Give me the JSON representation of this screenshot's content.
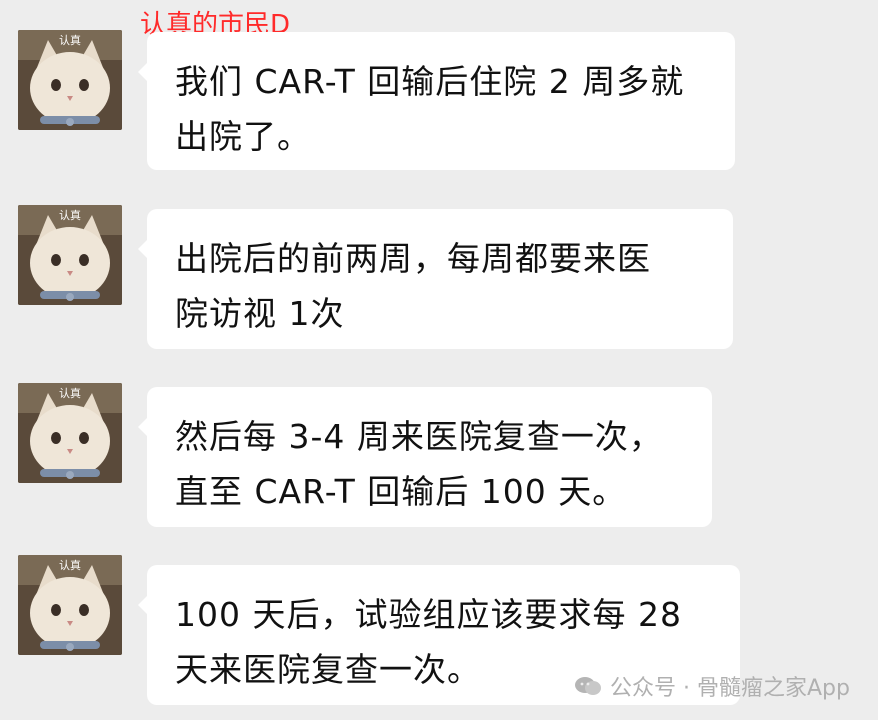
{
  "chat": {
    "sender_name": "认真的市民D",
    "avatar_label": "认真",
    "messages": [
      {
        "lines": [
          "我们 CAR-T 回输后住院 2 周多就",
          "出院了。"
        ]
      },
      {
        "lines": [
          "出院后的前两周，每周都要来医",
          "院访视 1次"
        ]
      },
      {
        "lines": [
          "然后每 3-4 周来医院复查一次，",
          "直至 CAR-T 回输后 100 天。"
        ]
      },
      {
        "lines": [
          "100 天后，试验组应该要求每 28",
          "天来医院复查一次。"
        ]
      }
    ]
  },
  "watermark": {
    "text": "公众号 · 骨髓瘤之家App",
    "icon": "wechat-official-account-icon"
  },
  "colors": {
    "background": "#ededed",
    "bubble": "#ffffff",
    "sender_name": "#ff2a2a",
    "watermark": "#b0b0b0"
  }
}
